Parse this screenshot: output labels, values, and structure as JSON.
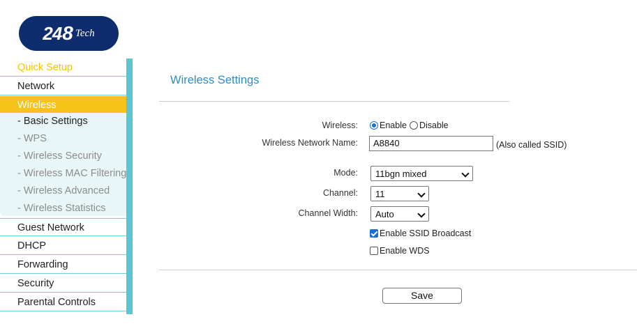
{
  "logo": {
    "num": "24",
    "num8": "8",
    "tech": "Tech"
  },
  "sidebar": {
    "items_top": [
      {
        "label": "Quick Setup"
      },
      {
        "label": "Network"
      },
      {
        "label": "Wireless"
      }
    ],
    "submenu": [
      {
        "label": "- Basic Settings"
      },
      {
        "label": "- WPS"
      },
      {
        "label": "- Wireless Security"
      },
      {
        "label": "- Wireless MAC Filtering"
      },
      {
        "label": "- Wireless Advanced"
      },
      {
        "label": "- Wireless Statistics"
      }
    ],
    "items_bottom": [
      {
        "label": "Guest Network"
      },
      {
        "label": "DHCP"
      },
      {
        "label": "Forwarding"
      },
      {
        "label": "Security"
      },
      {
        "label": "Parental Controls"
      }
    ]
  },
  "main": {
    "title": "Wireless Settings",
    "wireless_label": "Wireless:",
    "enable_label": "Enable",
    "disable_label": "Disable",
    "network_name_label": "Wireless Network Name:",
    "network_name_value": "A8840",
    "ssid_note": "(Also called SSID)",
    "mode_label": "Mode:",
    "mode_value": "11bgn mixed",
    "channel_label": "Channel:",
    "channel_value": "11",
    "channel_width_label": "Channel Width:",
    "channel_width_value": "Auto",
    "ssid_broadcast_label": "Enable SSID Broadcast",
    "wds_label": "Enable WDS",
    "save_label": "Save"
  },
  "colors": {
    "accent_yellow": "#f7c21a",
    "sidebar_rail": "#5bc5d2",
    "title_blue": "#2a8fc4",
    "logo_navy": "#0f2c6e",
    "control_blue": "#1a6fd6"
  }
}
